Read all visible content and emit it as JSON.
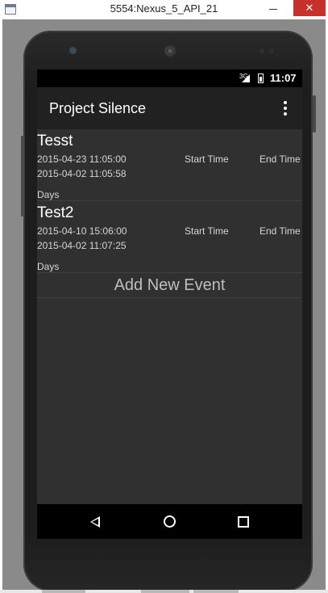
{
  "window": {
    "title": "5554:Nexus_5_API_21",
    "close_label": "✕"
  },
  "status_bar": {
    "network": "3G",
    "time": "11:07"
  },
  "toolbar": {
    "title": "Project Silence"
  },
  "events": [
    {
      "name": "Tesst",
      "line1": "2015-04-23 11:05:00",
      "line2": "2015-04-02 11:05:58",
      "start_label": "Start Time",
      "end_label": "End Time",
      "days_label": "Days"
    },
    {
      "name": "Test2",
      "line1": "2015-04-10 15:06:00",
      "line2": "2015-04-02 11:07:25",
      "start_label": "Start Time",
      "end_label": "End Time",
      "days_label": "Days"
    }
  ],
  "add_event_label": "Add New Event",
  "nav_icons": [
    "back-icon",
    "home-icon",
    "recent-apps-icon"
  ],
  "colors": {
    "screen_bg": "#303030",
    "toolbar_bg": "#212121",
    "close_button": "#c7312b"
  }
}
